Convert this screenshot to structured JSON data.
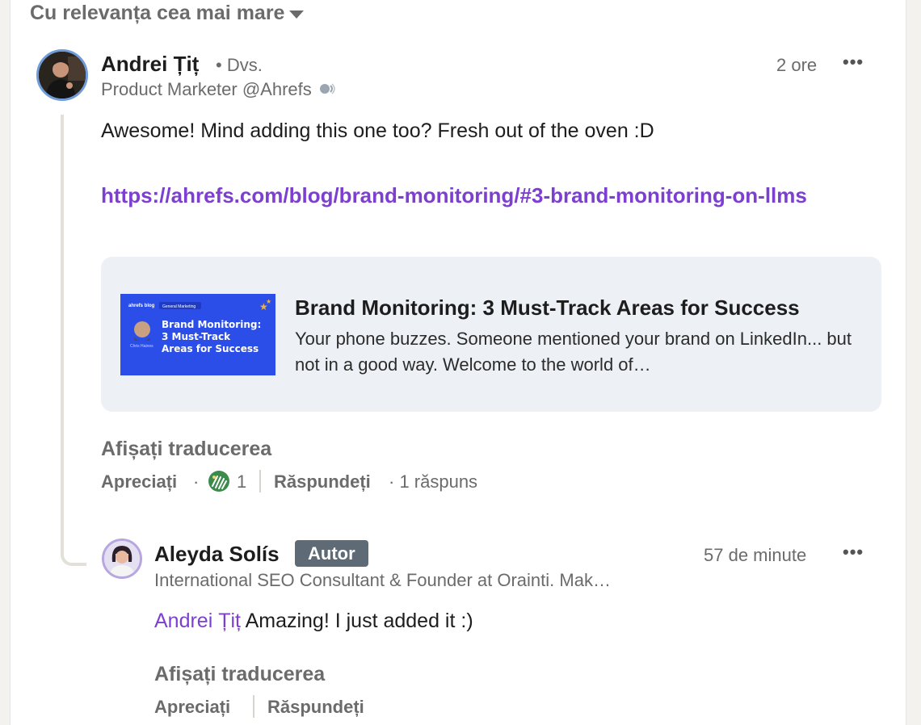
{
  "sort": {
    "label": "Cu relevanța cea mai mare"
  },
  "comment": {
    "author": "Andrei Țiț",
    "relation": "• Dvs.",
    "headline": "Product Marketer @Ahrefs",
    "time": "2 ore",
    "text": "Awesome! Mind adding this one too? Fresh out of the oven :D",
    "link": "https://ahrefs.com/blog/brand-monitoring/#3-brand-monitoring-on-llms",
    "preview": {
      "title": "Brand Monitoring: 3 Must-Track Areas for Success",
      "description": "Your phone buzzes. Someone mentioned your brand on LinkedIn... but not in a good way. Welcome to the world of…",
      "thumb_brand": "ahrefs blog",
      "thumb_tag": "General Marketing",
      "thumb_title": "Brand Monitoring: 3 Must-Track Areas for Success",
      "thumb_author": "Chris Haines"
    },
    "show_translation": "Afișați traducerea",
    "like_label": "Apreciați",
    "reaction_count": "1",
    "reply_label": "Răspundeți",
    "reply_count": "· 1 răspuns"
  },
  "reply": {
    "author": "Aleyda Solís",
    "badge": "Autor",
    "headline": "International SEO Consultant & Founder at Orainti. Mak…",
    "time": "57 de minute",
    "mention": "Andrei Țiț",
    "text": "Amazing! I just added it :)",
    "show_translation": "Afișați traducerea",
    "like_label": "Apreciați",
    "reply_label": "Răspundeți"
  },
  "colors": {
    "link": "#7c3fd0",
    "thumb_bg": "#2b4de8",
    "card_bg": "#edf1f5",
    "badge_bg": "#5e6a75"
  },
  "icons": [
    "chevron-down-icon",
    "more-icon",
    "speaker-icon",
    "celebrate-reaction-icon"
  ]
}
